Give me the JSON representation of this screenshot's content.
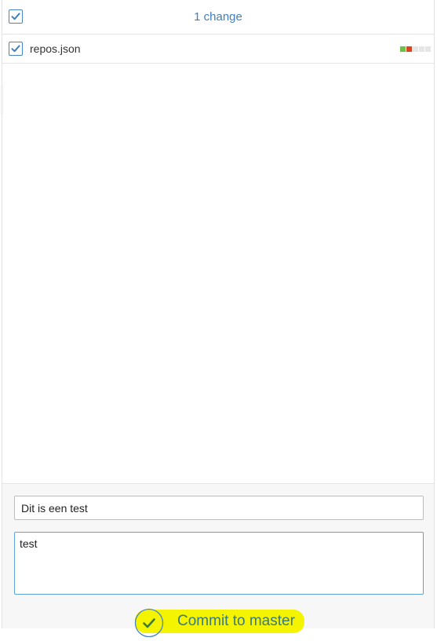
{
  "changes": {
    "count_label": "1 change",
    "select_all_checked": true
  },
  "files": [
    {
      "name": "repos.json",
      "checked": true,
      "diffstat": {
        "added_blocks": 1,
        "removed_blocks": 1,
        "neutral_blocks": 3
      }
    }
  ],
  "commit": {
    "summary_value": "Dit is een test",
    "description_value": "test",
    "button_label": "Commit to master"
  },
  "colors": {
    "accent": "#3f7fbf",
    "checkbox_border": "#4a86c5",
    "diff_added": "#6cbf4b",
    "diff_removed": "#d9451f",
    "diff_neutral": "#e6e6e6",
    "highlight": "#f4f400",
    "commit_text": "#3a7a7a"
  },
  "icons": {
    "select_all": "checkmark-icon",
    "file_checkbox": "checkmark-icon",
    "commit": "check-circle-icon"
  }
}
